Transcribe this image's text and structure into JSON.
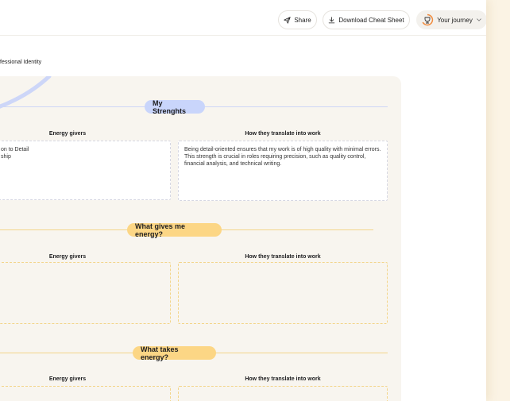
{
  "header": {
    "share_label": "Share",
    "download_label": "Download Cheat Sheet",
    "journey_label": "Your journey"
  },
  "breadcrumb": {
    "text": "fessional Identity"
  },
  "sections": [
    {
      "title": "My Strenghts",
      "col_left": "Energy givers",
      "col_right": "How they translate into work",
      "left_text": "on to Detail\nship",
      "right_text": "Being detail-oriented ensures that my work is of high quality with minimal errors. This strength is crucial in roles requiring precision, such as quality control, financial analysis, and technical writing."
    },
    {
      "title": "What gives me energy?",
      "col_left": "Energy givers",
      "col_right": "How they translate into work",
      "left_text": "",
      "right_text": ""
    },
    {
      "title": "What takes energy?",
      "col_left": "Energy givers",
      "col_right": "How they translate into work",
      "left_text": "",
      "right_text": ""
    }
  ],
  "colors": {
    "accent_blue": "#c9d5fb",
    "accent_yellow": "#fcd685",
    "panel_bg": "#f8f5ef",
    "journey_icon": "#f08a3c"
  },
  "icons": [
    "send-icon",
    "download-icon",
    "trophy-icon",
    "chevron-down-icon"
  ]
}
